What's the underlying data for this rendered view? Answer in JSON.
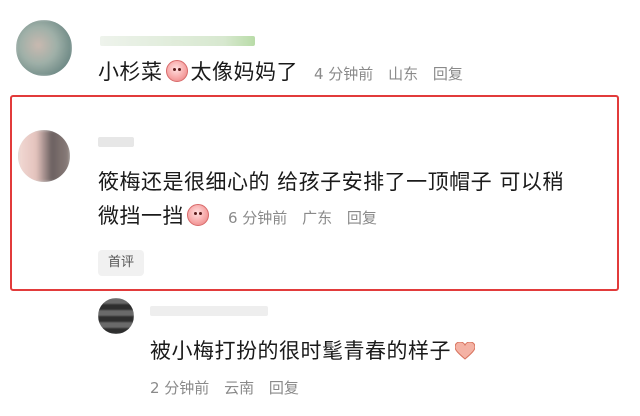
{
  "comments": [
    {
      "username": "小杉菜",
      "text_after_emoji": "太像妈妈了",
      "time": "4 分钟前",
      "location": "山东",
      "reply": "回复"
    },
    {
      "line1": "筱梅还是很细心的 给孩子安排了一顶帽子 可以稍",
      "line2": "微挡一挡",
      "time": "6 分钟前",
      "location": "广东",
      "reply": "回复",
      "tag": "首评",
      "highlight_color": "#e23b3b"
    },
    {
      "text": "被小梅打扮的很时髦青春的样子",
      "time": "2 分钟前",
      "location": "云南",
      "reply": "回复"
    }
  ],
  "icons": [
    "emoji-face-icon",
    "heart-icon"
  ]
}
